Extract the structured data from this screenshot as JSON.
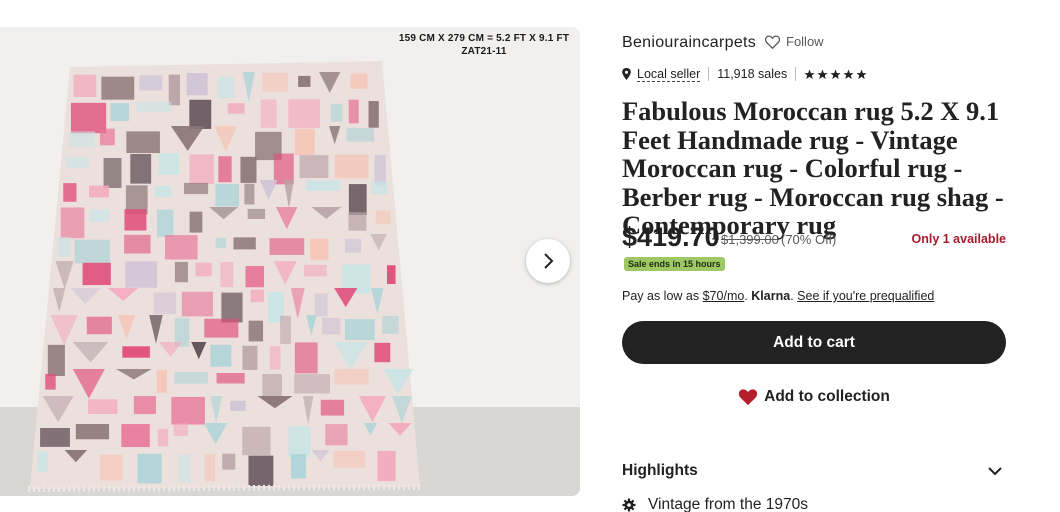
{
  "image": {
    "caption_line1": "159 CM X 279 CM = 5.2 FT X 9.1 FT",
    "caption_line2": "ZAT21-11"
  },
  "shop": {
    "name": "Beniouraincarpets",
    "follow_label": "Follow",
    "local_seller_label": "Local seller",
    "sales_label": "11,918 sales",
    "rating_stars": 5
  },
  "listing": {
    "title": "Fabulous Moroccan rug 5.2 X 9.1 Feet Handmade rug - Vintage Moroccan rug - Colorful rug - Berber rug - Moroccan rug shag - Contemporary rug",
    "price": "$419.70",
    "original_price": "$1,399.00",
    "discount": "(70% Off)",
    "availability": "Only 1 available",
    "sale_badge": "Sale ends in 15 hours"
  },
  "payment": {
    "prefix": "Pay as low as",
    "amount": "$70/mo",
    "period": ".",
    "brand": "Klarna",
    "brand_suffix": ".",
    "prequal_link": "See if you're prequalified"
  },
  "actions": {
    "add_to_cart": "Add to cart",
    "add_to_collection": "Add to collection"
  },
  "highlights": {
    "heading": "Highlights",
    "items": [
      "Vintage from the 1970s"
    ]
  },
  "icons": {
    "next": "chevron-right-icon",
    "follow": "heart-outline-icon",
    "location": "map-pin-icon",
    "star": "star-icon",
    "collection": "heart-filled-icon",
    "expand": "chevron-down-icon",
    "vintage": "gear-icon"
  },
  "colors": {
    "primary_button": "#222222",
    "sale_badge": "#9ec864",
    "availability": "#a61a2e",
    "collection_heart": "#b41f2c"
  }
}
